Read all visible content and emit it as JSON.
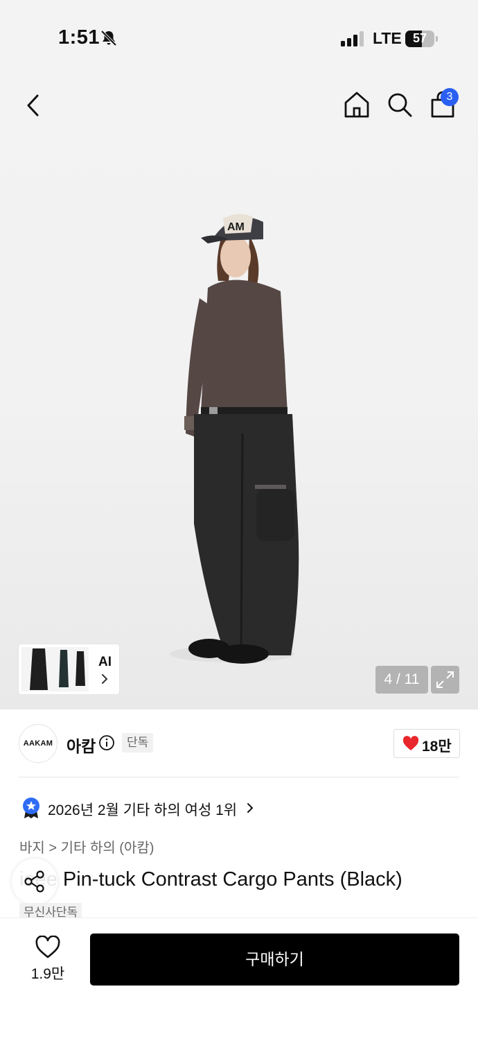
{
  "status_bar": {
    "time": "1:51",
    "network": "LTE",
    "battery": "57",
    "battery_level": 0.57
  },
  "nav": {
    "icons": [
      "back-icon",
      "home-icon",
      "search-icon",
      "shopping-bag-icon"
    ],
    "cart_badge": "3",
    "badge_color": "#2b5ff3"
  },
  "gallery": {
    "thumbnail_label": "AI",
    "counter": "4 / 11"
  },
  "brand": {
    "logo_text": "AAKAM",
    "name": "아캄",
    "tag": "단독",
    "likes": "18만",
    "like_color": "#e8262b"
  },
  "ranking": {
    "text": "2026년 2월 기타 하의 여성 1위"
  },
  "breadcrumb": "바지 > 기타 하의 (아캄)",
  "product": {
    "title": "ieee Pin-tuck Contrast Cargo Pants (Black)",
    "exclusive_tag": "무신사단독"
  },
  "bottom_bar": {
    "wishlist_count": "1.9만",
    "buy_label": "구매하기"
  }
}
